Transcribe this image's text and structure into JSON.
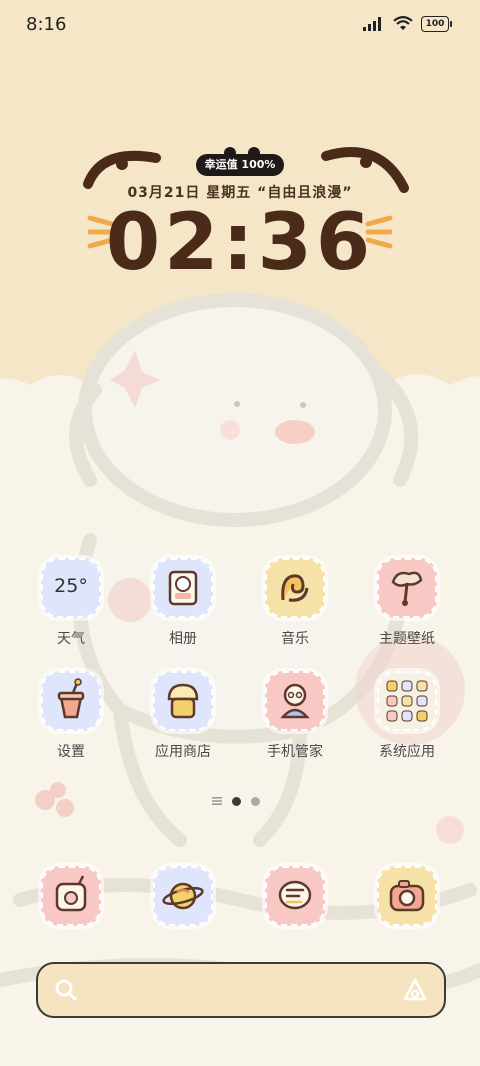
{
  "status_bar": {
    "time": "8:16",
    "battery": "100"
  },
  "clock_widget": {
    "luck": "幸运值 100%",
    "date_line": "03月21日  星期五  “自由且浪漫”",
    "time": "02:36"
  },
  "apps": [
    {
      "label": "天气",
      "icon": "weather-icon",
      "text": "25°",
      "bg": "#dfe6fb"
    },
    {
      "label": "相册",
      "icon": "gallery-icon",
      "bg": "#dfe6fb"
    },
    {
      "label": "音乐",
      "icon": "music-icon",
      "bg": "#f6e1a6"
    },
    {
      "label": "主题壁纸",
      "icon": "theme-wallpaper-icon",
      "bg": "#f8c9c4"
    },
    {
      "label": "设置",
      "icon": "settings-icon",
      "bg": "#dfe6fb"
    },
    {
      "label": "应用商店",
      "icon": "app-store-icon",
      "bg": "#dfe6fb"
    },
    {
      "label": "手机管家",
      "icon": "phone-manager-icon",
      "bg": "#f8c9c4"
    },
    {
      "label": "系统应用",
      "icon": "system-apps-folder-icon",
      "bg": "#f7f0e4"
    }
  ],
  "dock": [
    {
      "icon": "phone-icon",
      "bg": "#f8c9c4"
    },
    {
      "icon": "browser-icon",
      "bg": "#dfe6fb"
    },
    {
      "icon": "messages-icon",
      "bg": "#f8c9c4"
    },
    {
      "icon": "camera-icon",
      "bg": "#f6e1a6"
    }
  ],
  "page_indicator": {
    "pages": 2,
    "active": 1
  }
}
